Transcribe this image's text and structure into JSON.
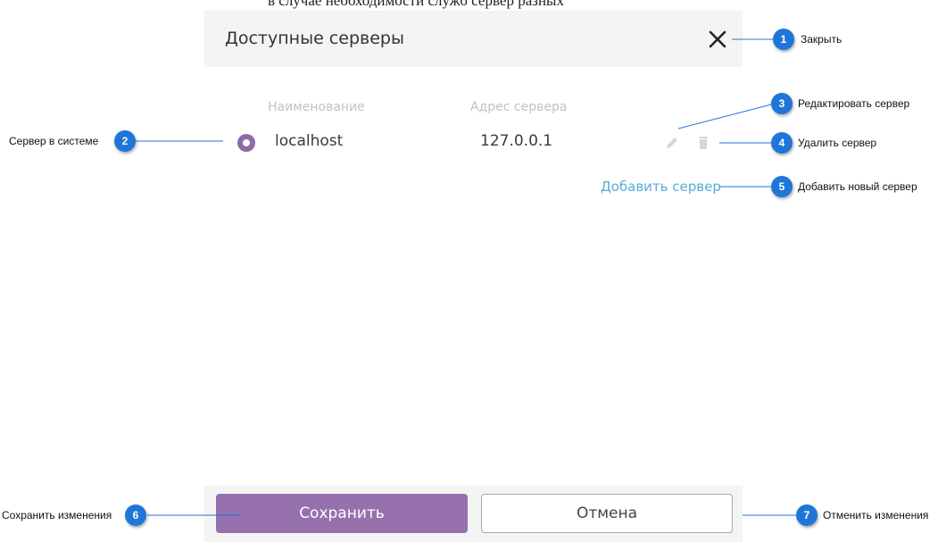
{
  "page_caption": "в случае необходимости служб сервер разных",
  "dialog": {
    "title": "Доступные серверы",
    "columns": {
      "name": "Наименование",
      "address": "Адрес сервера"
    },
    "server": {
      "name": "localhost",
      "address": "127.0.0.1",
      "selected": true
    },
    "add_link": "Добавить сервер",
    "save_label": "Сохранить",
    "cancel_label": "Отмена"
  },
  "icons": {
    "close": "close-icon",
    "edit": "pencil-icon",
    "delete": "trash-icon",
    "radio": "radio-selected-icon"
  },
  "callouts": [
    {
      "number": "1",
      "text": "Закрыть"
    },
    {
      "number": "2",
      "text": "Сервер в системе"
    },
    {
      "number": "3",
      "text": "Редактировать сервер"
    },
    {
      "number": "4",
      "text": "Удалить сервер"
    },
    {
      "number": "5",
      "text": "Добавить новый сервер"
    },
    {
      "number": "6",
      "text": "Сохранить изменения"
    },
    {
      "number": "7",
      "text": "Отменить изменения"
    }
  ],
  "colors": {
    "accent": "#9671ae",
    "link": "#5aaad8",
    "callout_badge": "#1f76d8"
  }
}
